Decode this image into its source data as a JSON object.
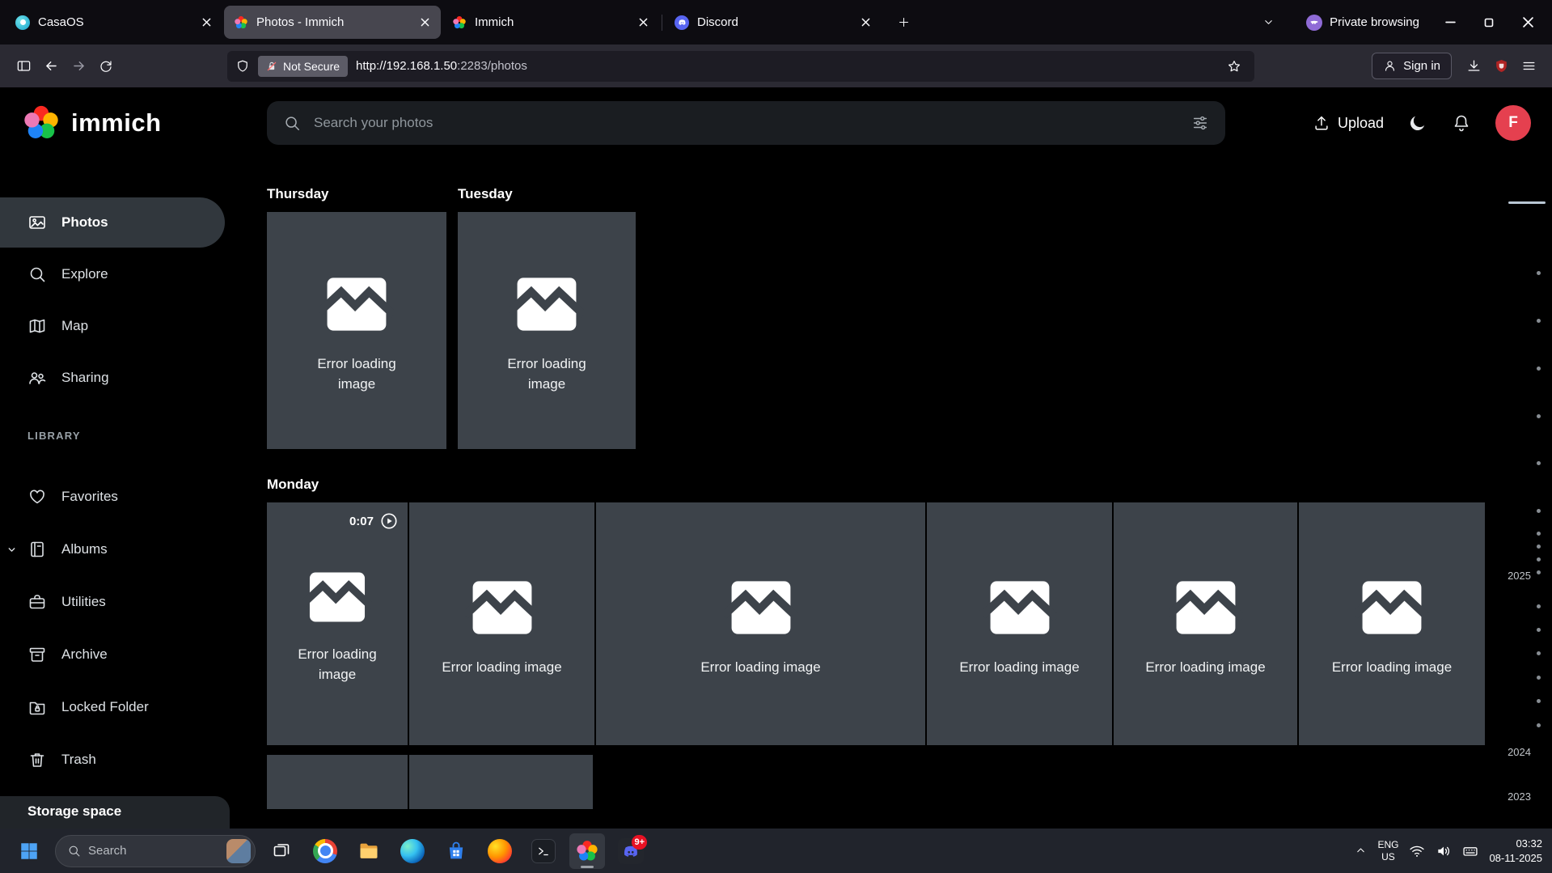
{
  "browser": {
    "tabs": [
      {
        "title": "CasaOS"
      },
      {
        "title": "Photos - Immich"
      },
      {
        "title": "Immich"
      },
      {
        "title": "Discord"
      }
    ],
    "private_label": "Private browsing",
    "toolbar": {
      "security_label": "Not Secure",
      "url_main": "http://192.168.1.50",
      "url_rest": ":2283/photos",
      "signin_label": "Sign in"
    }
  },
  "app": {
    "logo_text": "immich",
    "search_placeholder": "Search your photos",
    "upload_label": "Upload",
    "avatar_initial": "F",
    "sidebar": {
      "main_items": [
        {
          "label": "Photos"
        },
        {
          "label": "Explore"
        },
        {
          "label": "Map"
        },
        {
          "label": "Sharing"
        }
      ],
      "section_label": "LIBRARY",
      "library_items": [
        {
          "label": "Favorites"
        },
        {
          "label": "Albums"
        },
        {
          "label": "Utilities"
        },
        {
          "label": "Archive"
        },
        {
          "label": "Locked Folder"
        },
        {
          "label": "Trash"
        }
      ],
      "storage_label": "Storage space"
    },
    "timeline": {
      "groups": [
        {
          "title": "Thursday",
          "tiles": [
            {
              "error": "Error loading image"
            }
          ]
        },
        {
          "title": "Tuesday",
          "tiles": [
            {
              "error": "Error loading image"
            }
          ]
        },
        {
          "title": "Monday",
          "tiles": [
            {
              "error": "Error loading image",
              "duration": "0:07"
            },
            {
              "error": "Error loading image"
            },
            {
              "error": "Error loading image"
            },
            {
              "error": "Error loading image"
            },
            {
              "error": "Error loading image"
            },
            {
              "error": "Error loading image"
            }
          ]
        }
      ],
      "scrubber_years": [
        "2025",
        "2024",
        "2023"
      ]
    }
  },
  "taskbar": {
    "search_placeholder": "Search",
    "badge": "9+",
    "lang_line1": "ENG",
    "lang_line2": "US",
    "time": "03:32",
    "date": "08-11-2025"
  },
  "colors": {
    "tile_bg": "#3d434a",
    "avatar_bg": "#e5404f",
    "badge_bg": "#e81123",
    "private_accent": "#8f6bd6"
  }
}
